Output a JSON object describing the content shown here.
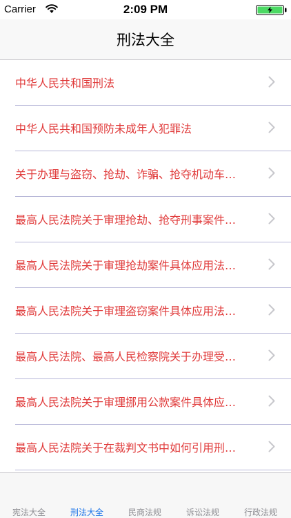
{
  "status_bar": {
    "carrier": "Carrier",
    "time": "2:09 PM",
    "wifi_icon": "wifi-icon",
    "battery_icon": "battery-icon",
    "battery_color": "#4cd964"
  },
  "nav": {
    "title": "刑法大全"
  },
  "list": {
    "text_color": "#e03a3a",
    "chevron_icon": "chevron-right-icon",
    "items": [
      {
        "label": "中华人民共和国刑法"
      },
      {
        "label": "中华人民共和国预防未成年人犯罪法"
      },
      {
        "label": "关于办理与盗窃、抢劫、诈骗、抢夺机动车…"
      },
      {
        "label": "最高人民法院关于审理抢劫、抢夺刑事案件…"
      },
      {
        "label": "最高人民法院关于审理抢劫案件具体应用法…"
      },
      {
        "label": "最高人民法院关于审理盗窃案件具体应用法…"
      },
      {
        "label": "最高人民法院、最高人民检察院关于办理受…"
      },
      {
        "label": "最高人民法院关于审理挪用公款案件具体应…"
      },
      {
        "label": "最高人民法院关于在裁判文书中如何引用刑…"
      }
    ]
  },
  "tab_bar": {
    "active_color": "#1a73e8",
    "tabs": [
      {
        "label": "宪法大全",
        "active": false
      },
      {
        "label": "刑法大全",
        "active": true
      },
      {
        "label": "民商法规",
        "active": false
      },
      {
        "label": "诉讼法规",
        "active": false
      },
      {
        "label": "行政法规",
        "active": false
      }
    ]
  }
}
